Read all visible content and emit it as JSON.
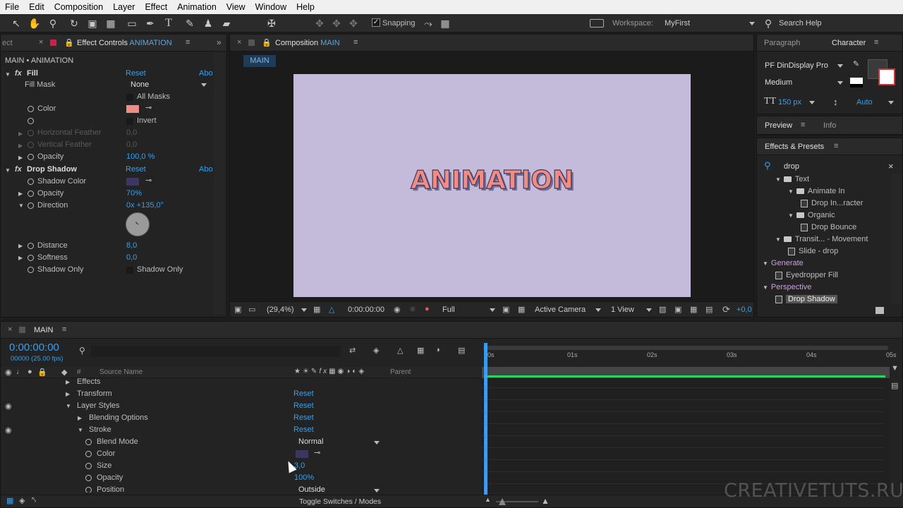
{
  "menu": [
    "File",
    "Edit",
    "Composition",
    "Layer",
    "Effect",
    "Animation",
    "View",
    "Window",
    "Help"
  ],
  "toolbar": {
    "snapping": "Snapping",
    "workspace_label": "Workspace:",
    "workspace_value": "MyFirst",
    "search_help": "Search Help"
  },
  "effect_controls": {
    "tab_prev": "ect",
    "tab_title": "Effect Controls",
    "tab_layer": "ANIMATION",
    "breadcrumb": "MAIN • ANIMATION",
    "fill": {
      "name": "Fill",
      "reset": "Reset",
      "about": "Abo",
      "fill_mask_label": "Fill Mask",
      "fill_mask_value": "None",
      "all_masks": "All Masks",
      "color_label": "Color",
      "color_value": "#f08c84",
      "invert": "Invert",
      "h_feather": "Horizontal Feather",
      "h_feather_val": "0,0",
      "v_feather": "Vertical Feather",
      "v_feather_val": "0,0",
      "opacity_label": "Opacity",
      "opacity_val": "100,0 %"
    },
    "drop_shadow": {
      "name": "Drop Shadow",
      "reset": "Reset",
      "about": "Abo",
      "shadow_color_label": "Shadow Color",
      "shadow_color_value": "#3c3760",
      "opacity_label": "Opacity",
      "opacity_val": "70%",
      "direction_label": "Direction",
      "direction_val": "0x +135,0°",
      "distance_label": "Distance",
      "distance_val": "8,0",
      "softness_label": "Softness",
      "softness_val": "0,0",
      "shadow_only_label": "Shadow Only",
      "shadow_only_check": "Shadow Only"
    }
  },
  "composition": {
    "tab_title": "Composition",
    "tab_name": "MAIN",
    "flow_tab": "MAIN",
    "canvas_text": "ANIMATION",
    "bg": "#c3bbd9",
    "footer": {
      "zoom": "(29,4%)",
      "time": "0:00:00:00",
      "resolution": "Full",
      "camera": "Active Camera",
      "views": "1 View",
      "exposure": "+0,0"
    }
  },
  "right_panel": {
    "tabs": [
      "Paragraph",
      "Character"
    ],
    "font": "PF DinDisplay Pro",
    "style": "Medium",
    "size": "150 px",
    "leading": "Auto",
    "preview_tabs": [
      "Preview",
      "Info"
    ],
    "effects_title": "Effects & Presets",
    "search": "drop",
    "tree": [
      {
        "label": "Text",
        "type": "folder",
        "indent": 1
      },
      {
        "label": "Animate In",
        "type": "folder",
        "indent": 2
      },
      {
        "label": "Drop In...racter",
        "type": "preset",
        "indent": 3
      },
      {
        "label": "Organic",
        "type": "folder",
        "indent": 2
      },
      {
        "label": "Drop Bounce",
        "type": "preset",
        "indent": 3
      },
      {
        "label": "Transit... - Movement",
        "type": "folder",
        "indent": 1
      },
      {
        "label": "Slide - drop",
        "type": "preset",
        "indent": 2
      },
      {
        "label": "Generate",
        "type": "category",
        "indent": 0
      },
      {
        "label": "Eyedropper Fill",
        "type": "preset",
        "indent": 1
      },
      {
        "label": "Perspective",
        "type": "category",
        "indent": 0
      },
      {
        "label": "Drop Shadow",
        "type": "preset",
        "indent": 1,
        "selected": true
      }
    ]
  },
  "timeline": {
    "tab": "MAIN",
    "timecode": "0:00:00:00",
    "fps": "00000 (25.00 fps)",
    "source_name": "Source Name",
    "hash": "#",
    "parent": "Parent",
    "ruler": [
      "0s",
      "01s",
      "02s",
      "03s",
      "04s",
      "05s"
    ],
    "rows": [
      {
        "label": "Effects",
        "indent": 1,
        "tri": "right",
        "reset": ""
      },
      {
        "label": "Transform",
        "indent": 1,
        "tri": "right",
        "reset": "Reset"
      },
      {
        "label": "Layer Styles",
        "indent": 1,
        "tri": "down",
        "reset": "Reset",
        "eye": true
      },
      {
        "label": "Blending Options",
        "indent": 2,
        "tri": "right",
        "reset": "Reset"
      },
      {
        "label": "Stroke",
        "indent": 2,
        "tri": "down",
        "reset": "Reset",
        "eye": true
      },
      {
        "label": "Blend Mode",
        "indent": 3,
        "stop": true,
        "value": "Normal",
        "dropdown": true
      },
      {
        "label": "Color",
        "indent": 3,
        "stop": true,
        "swatch": "#3c3760"
      },
      {
        "label": "Size",
        "indent": 3,
        "stop": true,
        "value": "3,0",
        "blue": true
      },
      {
        "label": "Opacity",
        "indent": 3,
        "stop": true,
        "value": "100%",
        "blue": true
      },
      {
        "label": "Position",
        "indent": 3,
        "stop": true,
        "value": "Outside",
        "dropdown": true
      }
    ],
    "toggle": "Toggle Switches / Modes"
  },
  "watermark": "CREATIVETUTS.RU"
}
